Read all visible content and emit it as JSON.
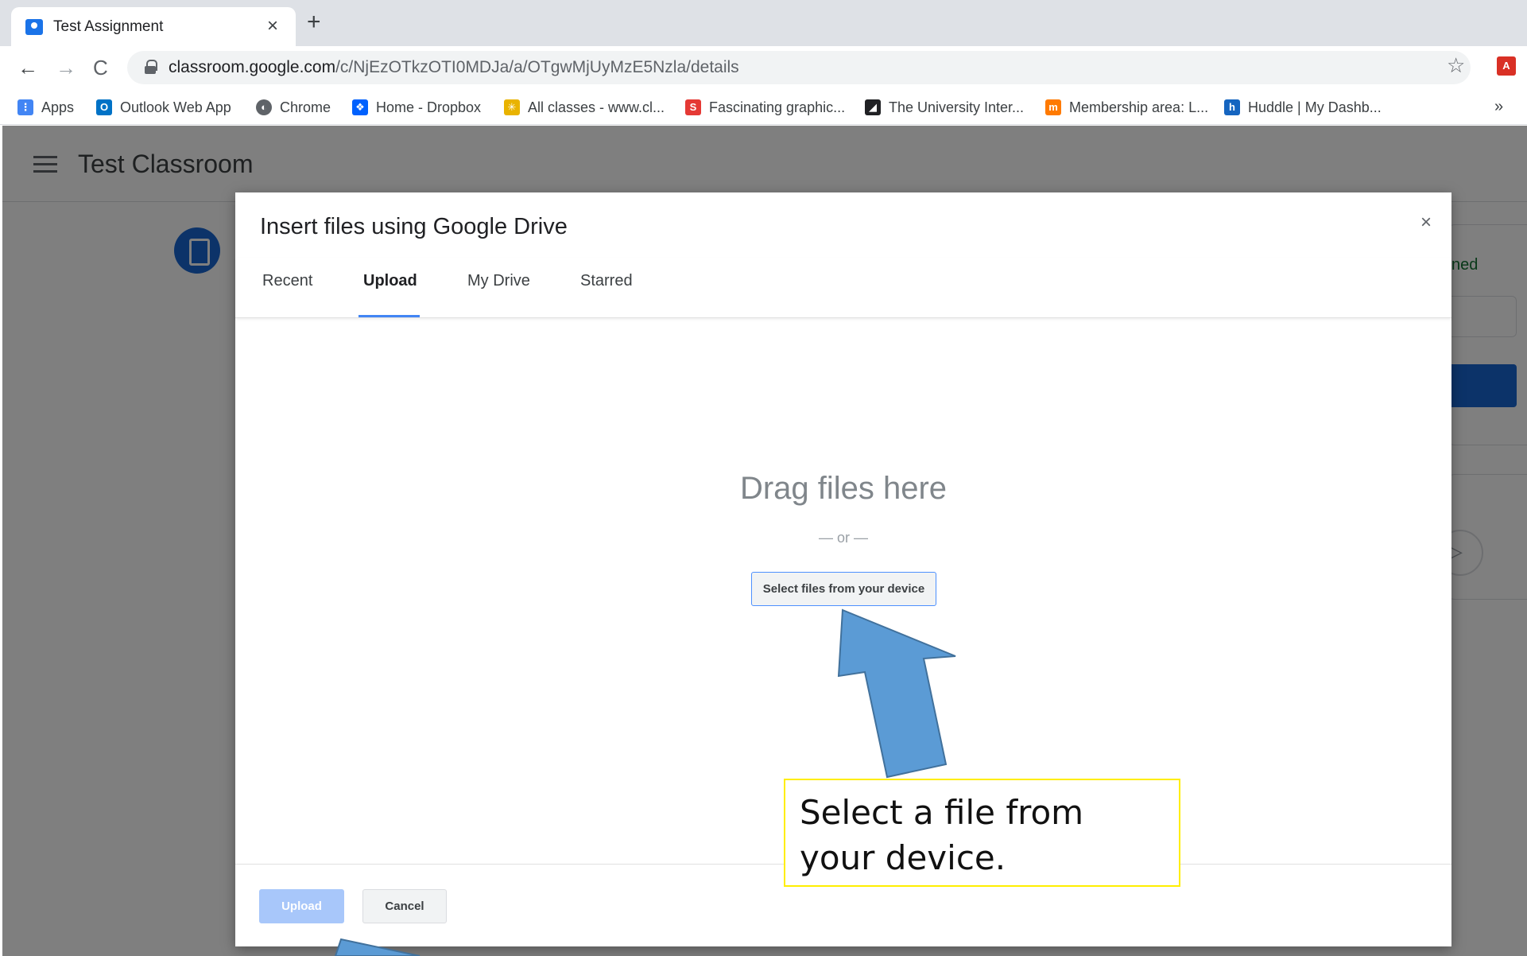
{
  "browser": {
    "tab_title": "Test Assignment",
    "tab_close": "×",
    "new_tab": "+",
    "nav_back": "←",
    "nav_forward": "→",
    "nav_reload": "C",
    "url_host": "classroom.google.com",
    "url_path": "/c/NjEzOTkzOTI0MDJa/a/OTgwMjUyMzE5Nzla/details",
    "star": "☆",
    "bookmarks": [
      {
        "label": "Apps",
        "icon": "apps-grid-icon",
        "color": "#4285f4",
        "glyph": "⋮⋮"
      },
      {
        "label": "Outlook Web App",
        "icon": "outlook-icon",
        "color": "#0072c6",
        "glyph": "O"
      },
      {
        "label": "Chrome",
        "icon": "chrome-icon",
        "color": "#5f6368",
        "glyph": "◐"
      },
      {
        "label": "Home - Dropbox",
        "icon": "dropbox-icon",
        "color": "#0061fe",
        "glyph": "❖"
      },
      {
        "label": "All classes - www.cl...",
        "icon": "classes-icon",
        "color": "#e9b300",
        "glyph": "✳"
      },
      {
        "label": "Fascinating graphic...",
        "icon": "s-logo-icon",
        "color": "#e53935",
        "glyph": "S"
      },
      {
        "label": "The University Inter...",
        "icon": "university-icon",
        "color": "#202124",
        "glyph": "◢"
      },
      {
        "label": "Membership area: L...",
        "icon": "membership-icon",
        "color": "#ff7a00",
        "glyph": "m"
      },
      {
        "label": "Huddle | My Dashb...",
        "icon": "huddle-icon",
        "color": "#1565c0",
        "glyph": "h"
      }
    ],
    "bookmarks_more": "»"
  },
  "app": {
    "class_title": "Test Classroom",
    "side_status_fragment": "ned"
  },
  "dialog": {
    "title": "Insert files using Google Drive",
    "close": "×",
    "tabs": [
      "Recent",
      "Upload",
      "My Drive",
      "Starred"
    ],
    "active_tab": "Upload",
    "drag_text": "Drag files here",
    "or_text": "— or —",
    "select_button": "Select files from your device",
    "upload_button": "Upload",
    "cancel_button": "Cancel"
  },
  "annotation": {
    "callout_text": "Select a file from your device.",
    "arrow_color": "#5b9bd5",
    "callout_border": "#ffee00"
  }
}
